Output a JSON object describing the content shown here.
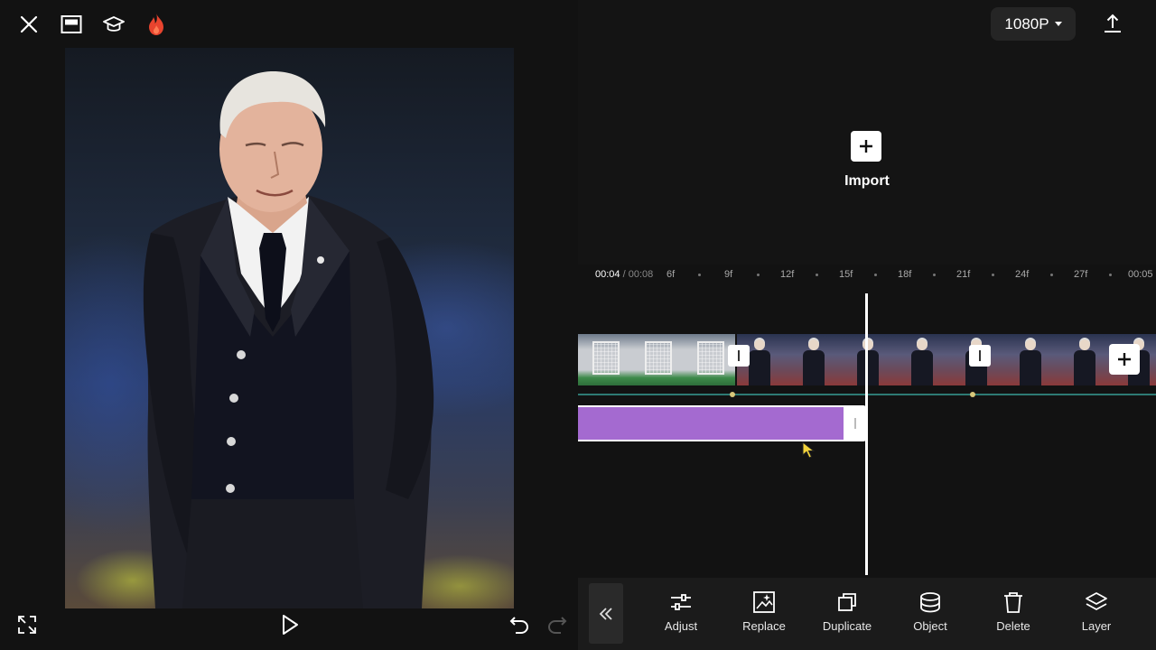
{
  "topbar": {
    "close_icon": "close-icon",
    "layout_icon": "layout-icon",
    "learn_icon": "graduation-cap-icon",
    "fire_icon": "fire-icon"
  },
  "preview": {
    "subject": "photo"
  },
  "playback": {
    "fullscreen_icon": "fullscreen-icon",
    "play_icon": "play-icon",
    "undo_icon": "undo-icon",
    "redo_icon": "redo-icon"
  },
  "header": {
    "resolution": "1080P",
    "export_icon": "export-icon"
  },
  "import": {
    "label": "Import"
  },
  "timeline": {
    "current_time": "00:04",
    "separator": " / ",
    "total_time": "00:08",
    "ticks": [
      "6f",
      "9f",
      "12f",
      "15f",
      "18f",
      "21f",
      "24f",
      "27f",
      "00:05"
    ]
  },
  "toolbar": {
    "tools": [
      {
        "label": "Adjust",
        "icon": "sliders-icon"
      },
      {
        "label": "Replace",
        "icon": "replace-icon"
      },
      {
        "label": "Duplicate",
        "icon": "duplicate-icon"
      },
      {
        "label": "Object",
        "icon": "object-icon"
      },
      {
        "label": "Delete",
        "icon": "trash-icon"
      },
      {
        "label": "Layer",
        "icon": "layers-icon"
      }
    ]
  },
  "colors": {
    "overlay_clip": "#a46ad0",
    "audio_line": "#2d7a73",
    "fire": "#e8442e"
  }
}
